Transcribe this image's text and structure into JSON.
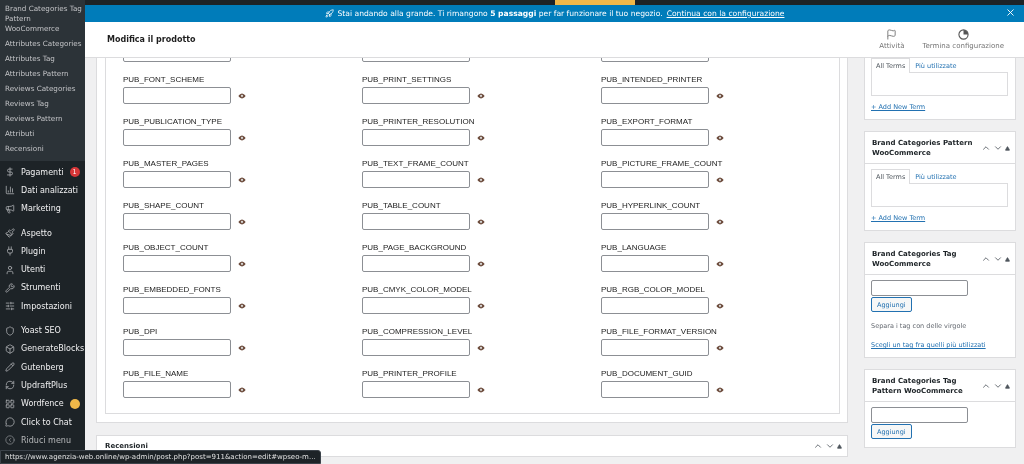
{
  "sidebar": {
    "submenu": [
      {
        "label": "Brand Categories Tag Pattern WooCommerce"
      },
      {
        "label": "Attributes Categories"
      },
      {
        "label": "Attributes Tag"
      },
      {
        "label": "Attributes Pattern"
      },
      {
        "label": "Reviews Categories"
      },
      {
        "label": "Reviews Tag"
      },
      {
        "label": "Reviews Pattern"
      },
      {
        "label": "Attributi"
      },
      {
        "label": "Recensioni"
      }
    ],
    "items": [
      {
        "label": "Pagamenti",
        "badge": {
          "text": "1",
          "color": "#d63638"
        }
      },
      {
        "label": "Dati analizzati"
      },
      {
        "label": "Marketing"
      },
      {
        "label": "Aspetto"
      },
      {
        "label": "Plugin"
      },
      {
        "label": "Utenti"
      },
      {
        "label": "Strumenti"
      },
      {
        "label": "Impostazioni"
      },
      {
        "label": "Yoast SEO"
      },
      {
        "label": "GenerateBlocks"
      },
      {
        "label": "Gutenberg"
      },
      {
        "label": "UpdraftPlus"
      },
      {
        "label": "Wordfence",
        "badge": {
          "color": "#f0b849"
        }
      },
      {
        "label": "Click to Chat"
      },
      {
        "label": "Riduci menu"
      }
    ]
  },
  "notice": {
    "text": "Stai andando alla grande. Ti rimangono **5 passaggi** per far funzionare il tuo negozio.",
    "link": "Continua con la configurazione"
  },
  "header": {
    "title": "Modifica il prodotto",
    "actions": [
      {
        "label": "Attività",
        "kind": "activity"
      },
      {
        "label": "Termina configurazione",
        "kind": "progress"
      }
    ]
  },
  "fields": [
    "PUB_FONT_SCHEME",
    "PUB_PRINT_SETTINGS",
    "PUB_INTENDED_PRINTER",
    "PUB_PUBLICATION_TYPE",
    "PUB_PRINTER_RESOLUTION",
    "PUB_EXPORT_FORMAT",
    "PUB_MASTER_PAGES",
    "PUB_TEXT_FRAME_COUNT",
    "PUB_PICTURE_FRAME_COUNT",
    "PUB_SHAPE_COUNT",
    "PUB_TABLE_COUNT",
    "PUB_HYPERLINK_COUNT",
    "PUB_OBJECT_COUNT",
    "PUB_PAGE_BACKGROUND",
    "PUB_LANGUAGE",
    "PUB_EMBEDDED_FONTS",
    "PUB_CMYK_COLOR_MODEL",
    "PUB_RGB_COLOR_MODEL",
    "PUB_DPI",
    "PUB_COMPRESSION_LEVEL",
    "PUB_FILE_FORMAT_VERSION",
    "PUB_FILE_NAME",
    "PUB_PRINTER_PROFILE",
    "PUB_DOCUMENT_GUID"
  ],
  "reviews_box": {
    "title": "Recensioni"
  },
  "side_boxes": [
    {
      "kind": "categories",
      "tabs": [
        {
          "label": "All Terms",
          "selected": true
        },
        {
          "label": "Più utilizzate",
          "selected": false
        }
      ],
      "link": "+ Add New Term"
    },
    {
      "kind": "categories",
      "title": "Brand Categories Pattern WooCommerce",
      "tabs": [
        {
          "label": "All Terms",
          "selected": true
        },
        {
          "label": "Più utilizzate",
          "selected": false
        }
      ],
      "link": "+ Add New Term"
    },
    {
      "kind": "tags",
      "title": "Brand Categories Tag WooCommerce",
      "button": "Aggiungi",
      "hint": "Separa i tag con delle virgole",
      "link": "Scegli un tag fra quelli più utilizzati"
    },
    {
      "kind": "tags",
      "title": "Brand Categories Tag Pattern WooCommerce",
      "button": "Aggiungi"
    }
  ],
  "status_url": "https://www.agenzia-web.online/wp-admin/post.php?post=911&action=edit#wpseo-m..."
}
